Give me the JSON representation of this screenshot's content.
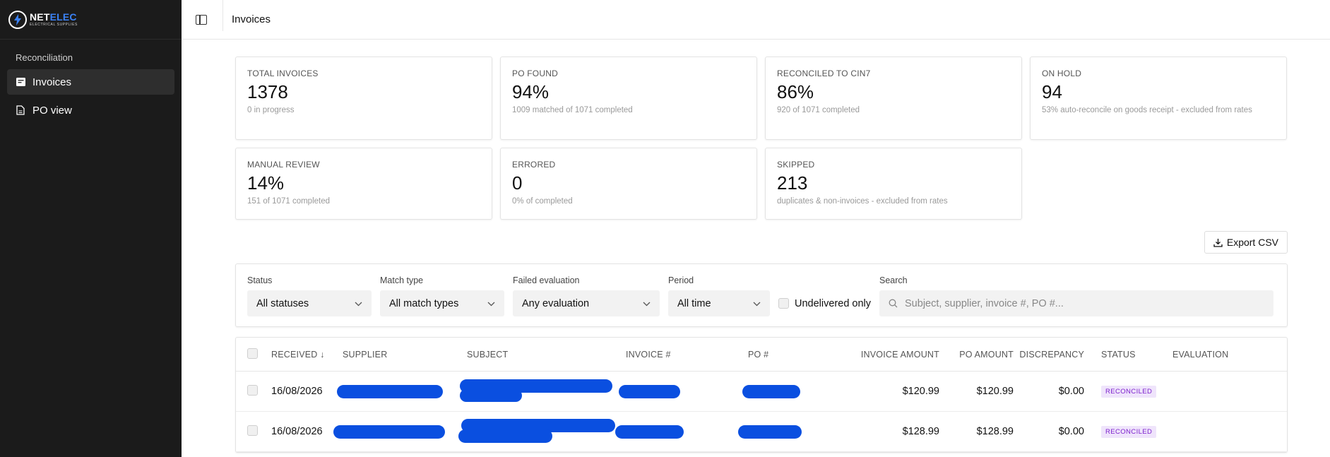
{
  "brand": {
    "name_a": "NET",
    "name_b": "ELEC",
    "tagline": "ELECTRICAL SUPPLIES",
    "accent": "#3b82f6"
  },
  "sidebar": {
    "group_label": "Reconciliation",
    "items": [
      {
        "label": "Invoices",
        "icon": "invoice-icon",
        "active": true
      },
      {
        "label": "PO view",
        "icon": "document-icon",
        "active": false
      }
    ]
  },
  "header": {
    "title": "Invoices"
  },
  "stats": [
    {
      "label": "TOTAL INVOICES",
      "value": "1378",
      "sub": "0 in progress"
    },
    {
      "label": "PO FOUND",
      "value": "94%",
      "sub": "1009 matched of 1071 completed"
    },
    {
      "label": "RECONCILED TO CIN7",
      "value": "86%",
      "sub": "920 of 1071 completed"
    },
    {
      "label": "ON HOLD",
      "value": "94",
      "sub": "53% auto-reconcile on goods receipt - excluded from rates"
    },
    {
      "label": "MANUAL REVIEW",
      "value": "14%",
      "sub": "151 of 1071 completed"
    },
    {
      "label": "ERRORED",
      "value": "0",
      "sub": "0% of completed"
    },
    {
      "label": "SKIPPED",
      "value": "213",
      "sub": "duplicates & non-invoices - excluded from rates"
    }
  ],
  "export_label": "Export CSV",
  "filters": {
    "status": {
      "label": "Status",
      "value": "All statuses"
    },
    "match_type": {
      "label": "Match type",
      "value": "All match types"
    },
    "failed_eval": {
      "label": "Failed evaluation",
      "value": "Any evaluation"
    },
    "period": {
      "label": "Period",
      "value": "All time"
    },
    "undelivered": {
      "label": "Undelivered only"
    },
    "search": {
      "label": "Search",
      "placeholder": "Subject, supplier, invoice #, PO #..."
    }
  },
  "table": {
    "columns": {
      "received": "RECEIVED ↓",
      "supplier": "SUPPLIER",
      "subject": "SUBJECT",
      "invoice": "INVOICE #",
      "po": "PO #",
      "invoice_amount": "INVOICE AMOUNT",
      "po_amount": "PO AMOUNT",
      "discrepancy": "DISCREPANCY",
      "status": "STATUS",
      "evaluation": "EVALUATION"
    },
    "rows": [
      {
        "received": "16/08/2026",
        "invoice_amount": "$120.99",
        "po_amount": "$120.99",
        "discrepancy": "$0.00",
        "status": "RECONCILED"
      },
      {
        "received": "16/08/2026",
        "invoice_amount": "$128.99",
        "po_amount": "$128.99",
        "discrepancy": "$0.00",
        "status": "RECONCILED"
      }
    ]
  },
  "colors": {
    "sidebar_bg": "#1b1b1b",
    "redaction": "#0a4fe0",
    "badge_bg": "#efe4fb",
    "badge_text": "#7e22ce"
  }
}
